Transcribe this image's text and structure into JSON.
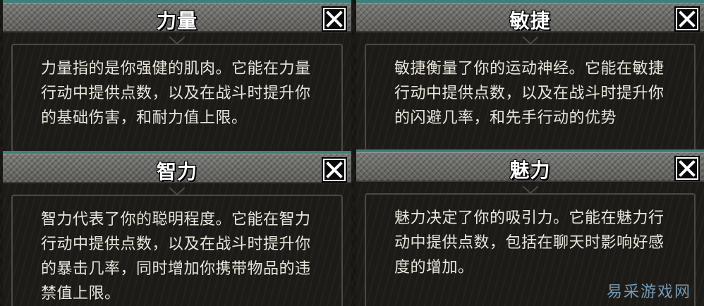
{
  "panels": [
    {
      "title": "力量",
      "description": "力量指的是你强健的肌肉。它能在力量行动中提供点数，以及在战斗时提升你的基础伤害，和耐力值上限。",
      "close_icon": "close-x-icon"
    },
    {
      "title": "敏捷",
      "description": "敏捷衡量了你的运动神经。它能在敏捷行动中提供点数，以及在战斗时提升你的闪避几率，和先手行动的优势",
      "close_icon": "close-x-icon"
    },
    {
      "title": "智力",
      "description": "智力代表了你的聪明程度。它能在智力行动中提供点数，以及在战斗时提升你的暴击几率，同时增加你携带物品的违禁值上限。",
      "close_icon": "close-x-icon"
    },
    {
      "title": "魅力",
      "description": "魅力决定了你的吸引力。它能在魅力行动中提供点数，包括在聊天时影响好感度的增加。",
      "close_icon": "close-x-icon"
    }
  ],
  "watermark": "易采游戏网",
  "colors": {
    "titlebar_top_border": "#3f7f7b",
    "titlebar": "#6c6b67",
    "text": "#e9e5dc",
    "panel_bg": "#1d1b17"
  }
}
